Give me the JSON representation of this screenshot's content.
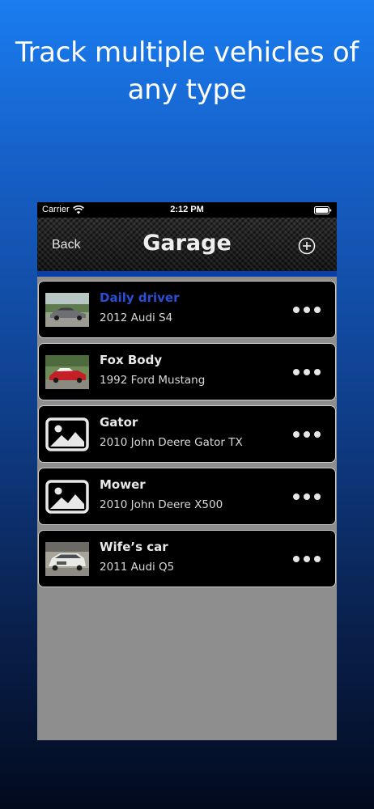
{
  "headline": "Track multiple vehicles of any type",
  "statusbar": {
    "carrier": "Carrier",
    "time": "2:12 PM"
  },
  "navbar": {
    "back_label": "Back",
    "title": "Garage"
  },
  "colors": {
    "accent_blue": "#2a4fd6",
    "nav_underline": "#0a3fa8",
    "list_bg": "#8e8e8e"
  },
  "vehicles": [
    {
      "name": "Daily driver",
      "model": "2012 Audi S4",
      "thumb": "photo-silver-sedan",
      "selected": true
    },
    {
      "name": "Fox Body",
      "model": "1992 Ford Mustang",
      "thumb": "photo-red-convertible",
      "selected": false
    },
    {
      "name": "Gator",
      "model": "2010 John Deere Gator TX",
      "thumb": "image-placeholder-icon",
      "selected": false
    },
    {
      "name": "Mower",
      "model": "2010 John Deere X500",
      "thumb": "image-placeholder-icon",
      "selected": false
    },
    {
      "name": "Wife’s car",
      "model": "2011 Audi Q5",
      "thumb": "photo-white-suv",
      "selected": false
    }
  ]
}
